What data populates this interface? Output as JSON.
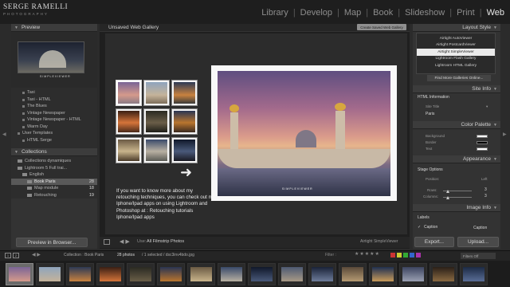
{
  "brand": {
    "name": "SERGE RAMELLI",
    "sub": "PHOTOGRAPHY"
  },
  "modules": [
    {
      "label": "Library",
      "active": false
    },
    {
      "label": "Develop",
      "active": false
    },
    {
      "label": "Map",
      "active": false
    },
    {
      "label": "Book",
      "active": false
    },
    {
      "label": "Slideshow",
      "active": false
    },
    {
      "label": "Print",
      "active": false
    },
    {
      "label": "Web",
      "active": true
    }
  ],
  "left_panel": {
    "preview_title": "Preview",
    "preview_caption": "SIMPLEVIEWER",
    "templates": [
      "Taxi",
      "Taxi - HTML",
      "The Blues",
      "Vintage Newspaper",
      "Vintage Newspaper - HTML",
      "Warm Day",
      "User Templates",
      "HTML Serge"
    ],
    "collections_title": "Collections",
    "collections": [
      {
        "label": "Collections dynamiques",
        "count": "",
        "selected": false
      },
      {
        "label": "Lightroom 5 Full trai...",
        "count": "",
        "selected": false
      },
      {
        "label": "English",
        "count": "",
        "selected": false
      },
      {
        "label": "Book Paris",
        "count": "28",
        "selected": true
      },
      {
        "label": "Map module",
        "count": "18",
        "selected": false
      },
      {
        "label": "Retouching",
        "count": "19",
        "selected": false
      }
    ],
    "preview_button": "Preview in Browser..."
  },
  "center": {
    "gallery_title": "Unsaved Web Gallery",
    "create_button": "Create Saved Web Gallery",
    "info_text": "If you want to know more about my retouching techniques, you can check out my Iphone/Ipad apps on using Lightroom and Photoshop at : Retouching tutorials Iphone/Ipad apps",
    "photo_caption": "SIMPLEVIEWER",
    "use_label": "Use:",
    "use_value": "All Filmstrip Photos",
    "layout_label": "Airtight SimpleViewer"
  },
  "right_panel": {
    "layout_style_title": "Layout Style",
    "layout_styles": [
      {
        "label": "Airtight AutoViewer",
        "selected": false
      },
      {
        "label": "Airtight PostcardViewer",
        "selected": false
      },
      {
        "label": "Airtight SimpleViewer",
        "selected": true
      },
      {
        "label": "Lightroom Flash Gallery",
        "selected": false
      },
      {
        "label": "Lightroom HTML Gallery",
        "selected": false
      }
    ],
    "find_more": "Find More Galleries Online...",
    "site_info_title": "Site Info",
    "html_info_label": "HTML Information",
    "site_title_label": "Site Title",
    "site_title_value": "Paris",
    "color_palette_title": "Color Palette",
    "color_rows": [
      {
        "label": "Background",
        "color": "#ffffff"
      },
      {
        "label": "Border",
        "color": "#000000"
      },
      {
        "label": "Text",
        "color": "#ffffff"
      }
    ],
    "appearance_title": "Appearance",
    "stage_options": "Stage Options",
    "position_label": "Position:",
    "position_value": "Left",
    "rows_label": "Rows:",
    "rows_value": "3",
    "columns_label": "Columns:",
    "columns_value": "3",
    "image_info_title": "Image Info",
    "labels_label": "Labels",
    "caption_check": "Caption",
    "caption_value": "Caption",
    "export_button": "Export...",
    "upload_button": "Upload..."
  },
  "filmstrip_bar": {
    "page1": "1",
    "page2": "2",
    "nav": "◀ ▶",
    "collection": "Collection : Book Paris",
    "photos": "28 photos",
    "selected": "/ 1 selected / dsc3inv4bdo.jpg",
    "filter_label": "Filter :",
    "stars": "★★★★★",
    "filter_off": "Filters Off"
  },
  "colors": {
    "accent": "#e8e8e8",
    "panel": "#333333",
    "canvas": "#2c2c2c"
  }
}
